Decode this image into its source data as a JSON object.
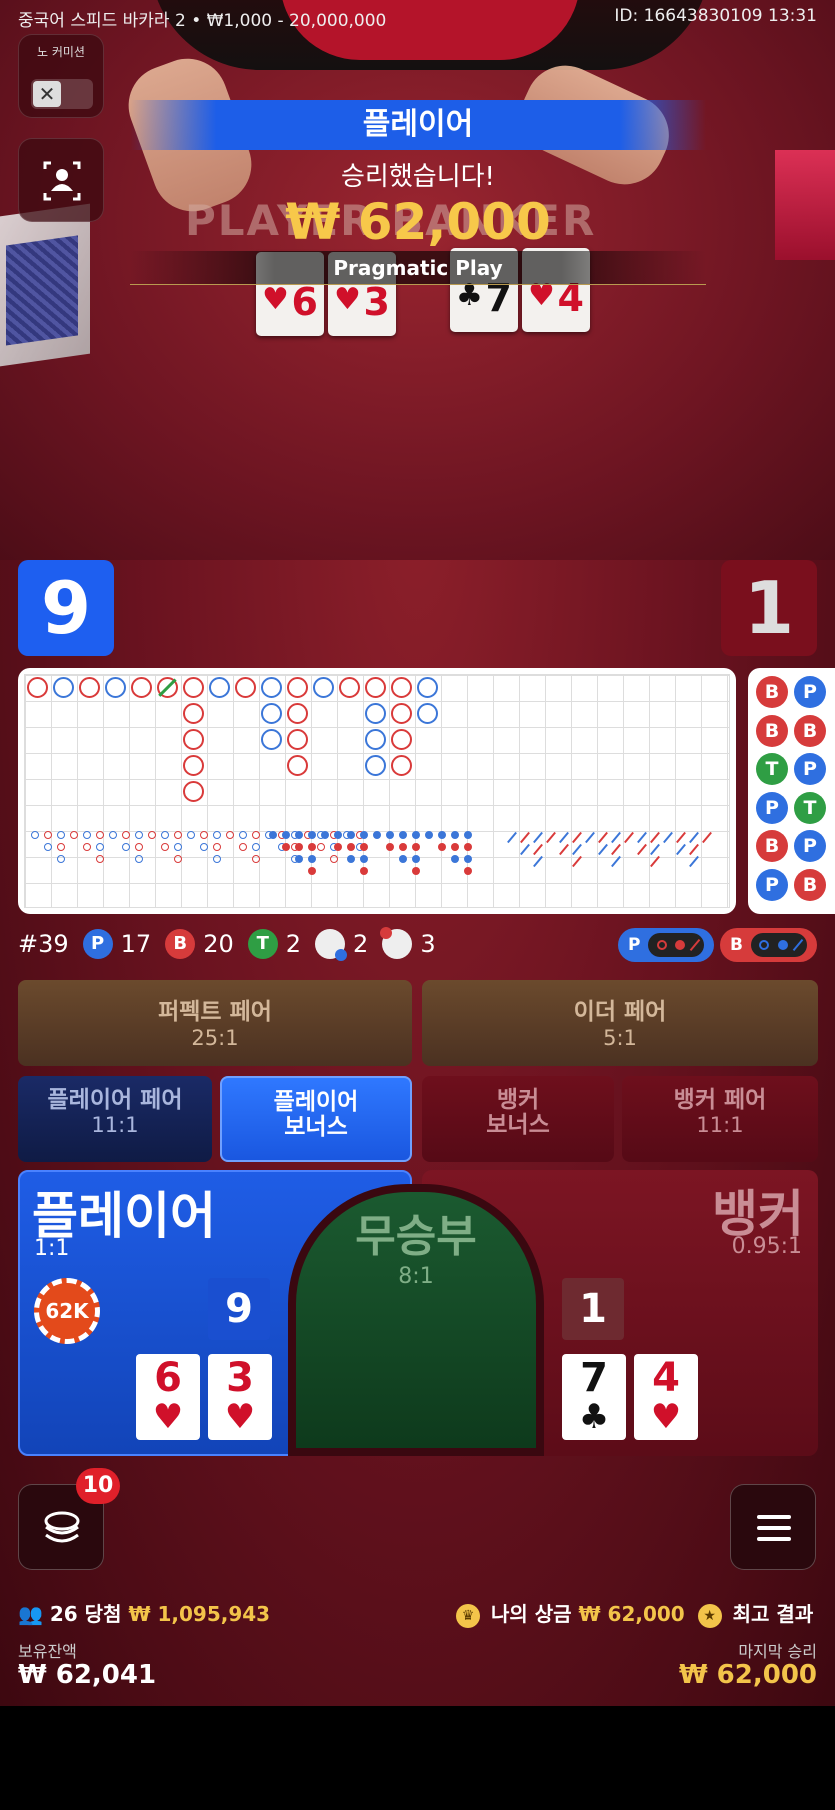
{
  "header": {
    "game_info": "중국어 스피드 바카라 2 • ₩1,000 - 20,000,000",
    "round_id": "ID: 16643830109 13:31"
  },
  "no_commission": {
    "label": "노 커미션",
    "toggle_icon": "✕"
  },
  "win_banner": {
    "side": "플레이어",
    "message": "승리했습니다!",
    "amount": "₩ 62,000",
    "background_text": "PLAYER BANKER",
    "provider": "Pragmatic Play"
  },
  "table_cards": {
    "player": [
      {
        "value": "6",
        "suit": "♥"
      },
      {
        "value": "3",
        "suit": "♥"
      }
    ],
    "banker": [
      {
        "value": "7",
        "suit": "♣"
      },
      {
        "value": "4",
        "suit": "♥"
      }
    ]
  },
  "scores": {
    "player": "9",
    "banker": "1"
  },
  "bead_road": [
    "B",
    "P",
    "B",
    "B",
    "T",
    "P",
    "P",
    "T",
    "B",
    "P",
    "P",
    "B"
  ],
  "stats": {
    "round": "#39",
    "player_label": "P",
    "player_count": "17",
    "banker_label": "B",
    "banker_count": "20",
    "tie_label": "T",
    "tie_count": "2",
    "player_pair_count": "2",
    "banker_pair_count": "3"
  },
  "predict": {
    "player_label": "P",
    "banker_label": "B"
  },
  "bets": {
    "perfect_pair": {
      "label": "퍼펙트 페어",
      "odds": "25:1"
    },
    "either_pair": {
      "label": "이더 페어",
      "odds": "5:1"
    },
    "player_pair": {
      "label": "플레이어 페어",
      "odds": "11:1"
    },
    "player_bonus": {
      "label1": "플레이어",
      "label2": "보너스"
    },
    "banker_bonus": {
      "label1": "뱅커",
      "label2": "보너스"
    },
    "banker_pair": {
      "label": "뱅커 페어",
      "odds": "11:1"
    },
    "player": {
      "label": "플레이어",
      "odds": "1:1",
      "score": "9",
      "chip": "62K"
    },
    "tie": {
      "label": "무승부",
      "odds": "8:1"
    },
    "banker": {
      "label": "뱅커",
      "odds": "0.95:1",
      "score": "1"
    }
  },
  "hand_cards": {
    "player": [
      {
        "value": "6",
        "suit": "♥"
      },
      {
        "value": "3",
        "suit": "♥"
      }
    ],
    "banker": [
      {
        "value": "7",
        "suit": "♣"
      },
      {
        "value": "4",
        "suit": "♥"
      }
    ]
  },
  "chips_badge": "10",
  "footer": {
    "winners": "26 당첨",
    "winners_amount": "₩ 1,095,943",
    "my_winnings_label": "나의 상금",
    "my_winnings": "₩ 62,000",
    "best_results_label": "최고 결과",
    "balance_label": "보유잔액",
    "balance": "₩ 62,041",
    "last_win_label": "마지막 승리",
    "last_win": "₩ 62,000"
  },
  "colors": {
    "player": "#1e5ff0",
    "banker": "#d63b3b",
    "tie": "#2f9e44",
    "gold": "#f3c44a"
  }
}
